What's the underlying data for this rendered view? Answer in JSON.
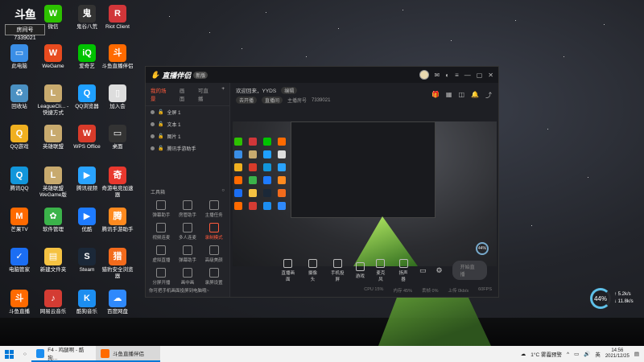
{
  "overlay": {
    "room_label": "房间号",
    "room_number": "7339021"
  },
  "desktop_icons": [
    {
      "label": "微信",
      "color": "#2dc100",
      "glyph": "W"
    },
    {
      "label": "鬼谷八荒",
      "color": "#333333",
      "glyph": "鬼"
    },
    {
      "label": "Riot Client",
      "color": "#d13639",
      "glyph": "R"
    },
    {
      "label": "此电脑",
      "color": "#3a8ee6",
      "glyph": "▭"
    },
    {
      "label": "WeGame",
      "color": "#e84b1f",
      "glyph": "W"
    },
    {
      "label": "爱奇艺",
      "color": "#00c300",
      "glyph": "iQ"
    },
    {
      "label": "斗鱼直播伴侣",
      "color": "#ff6a00",
      "glyph": "斗"
    },
    {
      "label": "回收站",
      "color": "#4a90c2",
      "glyph": "♻"
    },
    {
      "label": "LeagueCli... - 快捷方式",
      "color": "#c8aa6e",
      "glyph": "L"
    },
    {
      "label": "QQ浏览器",
      "color": "#1fa0ff",
      "glyph": "Q"
    },
    {
      "label": "加入会",
      "color": "#dddddd",
      "glyph": "▯"
    },
    {
      "label": "QQ游戏",
      "color": "#f0b020",
      "glyph": "Q"
    },
    {
      "label": "英雄联盟",
      "color": "#c8aa6e",
      "glyph": "L"
    },
    {
      "label": "WPS Office",
      "color": "#d83b2a",
      "glyph": "W"
    },
    {
      "label": "桌面",
      "color": "#333333",
      "glyph": "▭"
    },
    {
      "label": "腾讯QQ",
      "color": "#1296db",
      "glyph": "Q"
    },
    {
      "label": "英雄联盟 WeGame版",
      "color": "#c8aa6e",
      "glyph": "L"
    },
    {
      "label": "腾讯视频",
      "color": "#29a3ff",
      "glyph": "▶"
    },
    {
      "label": "奇游电竞加速器",
      "color": "#e8382e",
      "glyph": "奇"
    },
    {
      "label": "芒果TV",
      "color": "#ff6a00",
      "glyph": "M"
    },
    {
      "label": "软件管理",
      "color": "#3bb34a",
      "glyph": "✿"
    },
    {
      "label": "优酷",
      "color": "#1e7bff",
      "glyph": "▶"
    },
    {
      "label": "腾讯手游助手",
      "color": "#ff8a1f",
      "glyph": "腾"
    },
    {
      "label": "电脑管家",
      "color": "#1b6ef3",
      "glyph": "✓"
    },
    {
      "label": "新建文件夹",
      "color": "#f5c242",
      "glyph": "▤"
    },
    {
      "label": "Steam",
      "color": "#1b2838",
      "glyph": "S"
    },
    {
      "label": "猎豹安全浏览器",
      "color": "#f36b1c",
      "glyph": "猎"
    },
    {
      "label": "斗鱼直播",
      "color": "#ff6a00",
      "glyph": "斗"
    },
    {
      "label": "网易云音乐",
      "color": "#d43c33",
      "glyph": "♪"
    },
    {
      "label": "酷狗音乐",
      "color": "#1c8ef0",
      "glyph": "K"
    },
    {
      "label": "百度网盘",
      "color": "#2f89fc",
      "glyph": "☁"
    }
  ],
  "app": {
    "brand": "直播伴侣",
    "version_badge": "新版",
    "tabs": [
      "我的场景",
      "画面",
      "可直播"
    ],
    "scenes": [
      "全屏 1",
      "文本 1",
      "图片 1",
      "腾讯手游助手"
    ],
    "tools_title": "工具箱",
    "tools": [
      "弹幕助手",
      "房管助手",
      "主播任务",
      "视频连麦",
      "多人连麦",
      "录制模式",
      "虚拟直播",
      "弹幕助手",
      "高级美颜",
      "分屏开播",
      "画中画",
      "录屏设置"
    ],
    "notice": "你可把手机画面投屏到电脑哦~",
    "welcome": "欢迎回来，YYDS",
    "welcome_pill": "编辑",
    "info_pill_1": "去开播",
    "info_pill_2": "直播间",
    "room_id_label": "主播房号",
    "room_id": "7339021",
    "controls": [
      "直播画面",
      "摄像头",
      "手机投屏",
      "游戏",
      "麦克风",
      "扬声器"
    ],
    "start_label": "开始直播",
    "status": [
      "CPU 15%",
      "内存 45%",
      "丢帧 0%",
      "上传 0kb/s",
      "60FPS"
    ]
  },
  "perf_widget": {
    "percent": "44%",
    "up": "5.2k/s",
    "down": "11.8k/s"
  },
  "taskbar": {
    "apps": [
      {
        "label": "F4 - 鸡腿啊 - 酷狗...",
        "color": "#1c8ef0"
      },
      {
        "label": "斗鱼直播伴侣",
        "color": "#ff6a00"
      }
    ],
    "weather": "1°C 雾霾预警",
    "lang": "英",
    "time": "14:56",
    "date": "2021/12/25"
  }
}
